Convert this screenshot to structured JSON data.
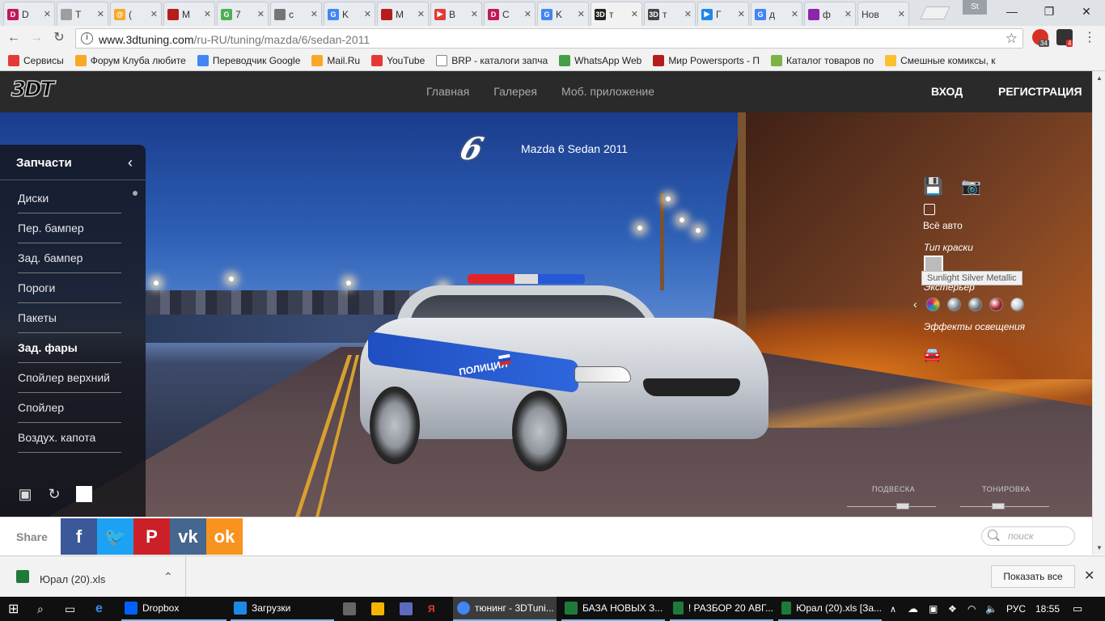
{
  "browser": {
    "tabs": [
      {
        "label": "D",
        "fav_color": "#c2185b",
        "fav_glyph": "D",
        "active": false
      },
      {
        "label": "T",
        "fav_color": "#9e9e9e",
        "fav_glyph": "",
        "active": false
      },
      {
        "label": "(",
        "fav_color": "#f9a825",
        "fav_glyph": "@",
        "active": false
      },
      {
        "label": "M",
        "fav_color": "#b71c1c",
        "fav_glyph": "",
        "active": false
      },
      {
        "label": "7",
        "fav_color": "#4caf50",
        "fav_glyph": "G",
        "active": false
      },
      {
        "label": "c",
        "fav_color": "#757575",
        "fav_glyph": "",
        "active": false
      },
      {
        "label": "K",
        "fav_color": "#4285f4",
        "fav_glyph": "G",
        "active": false
      },
      {
        "label": "M",
        "fav_color": "#b71c1c",
        "fav_glyph": "",
        "active": false
      },
      {
        "label": "B",
        "fav_color": "#e53935",
        "fav_glyph": "▶",
        "active": false
      },
      {
        "label": "C",
        "fav_color": "#c2185b",
        "fav_glyph": "D",
        "active": false
      },
      {
        "label": "K",
        "fav_color": "#4285f4",
        "fav_glyph": "G",
        "active": false
      },
      {
        "label": "т",
        "fav_color": "#222222",
        "fav_glyph": "3D",
        "active": true
      },
      {
        "label": "т",
        "fav_color": "#444444",
        "fav_glyph": "3D",
        "active": false
      },
      {
        "label": "Г",
        "fav_color": "#1e88e5",
        "fav_glyph": "▶",
        "active": false
      },
      {
        "label": "д",
        "fav_color": "#4285f4",
        "fav_glyph": "G",
        "active": false
      },
      {
        "label": "ф",
        "fav_color": "#8e24aa",
        "fav_glyph": "",
        "active": false
      },
      {
        "label": "Нов",
        "fav_color": "",
        "fav_glyph": "",
        "active": false
      }
    ],
    "profile_label": "St",
    "url_host": "www.3dtuning.com",
    "url_path": "/ru-RU/tuning/mazda/6/sedan-2011",
    "ext_badges": [
      "34",
      "4"
    ]
  },
  "bookmarks": [
    {
      "label": "Сервисы",
      "color": "#e53935"
    },
    {
      "label": "Форум Клуба любите",
      "color": "#f9a825"
    },
    {
      "label": "Переводчик Google",
      "color": "#4285f4"
    },
    {
      "label": "Mail.Ru",
      "color": "#f9a825"
    },
    {
      "label": "YouTube",
      "color": "#e53935"
    },
    {
      "label": "BRP - каталоги запча",
      "color": "#ffffff"
    },
    {
      "label": "WhatsApp Web",
      "color": "#43a047"
    },
    {
      "label": "Мир Powersports - П",
      "color": "#b71c1c"
    },
    {
      "label": "Каталог товаров по",
      "color": "#7cb342"
    },
    {
      "label": "Смешные комиксы, к",
      "color": "#fbc02d"
    }
  ],
  "site": {
    "logo": "3DT",
    "nav": [
      "Главная",
      "Галерея",
      "Моб. приложение"
    ],
    "login": "ВХОД",
    "register": "РЕГИСТРАЦИЯ",
    "model_logo": "6",
    "model_name": "Mazda 6 Sedan 2011",
    "car_text": "ПОЛИЦИЯ"
  },
  "panel": {
    "title": "Запчасти",
    "items": [
      {
        "label": "Диски",
        "active": false
      },
      {
        "label": "Пер. бампер",
        "active": false
      },
      {
        "label": "Зад. бампер",
        "active": false
      },
      {
        "label": "Пороги",
        "active": false
      },
      {
        "label": "Пакеты",
        "active": false
      },
      {
        "label": "Зад. фары",
        "active": true
      },
      {
        "label": "Спойлер верхний",
        "active": false
      },
      {
        "label": "Спойлер",
        "active": false
      },
      {
        "label": "Воздух. капота",
        "active": false
      }
    ]
  },
  "right_tools": {
    "all_car": "Всё авто",
    "paint_type": "Тип краски",
    "tooltip": "Sunlight Silver Metallic",
    "exterior": "Экстерьер",
    "lighting": "Эффекты освещения",
    "swatches": [
      "#9e9e9e",
      "#8a8e94",
      "#7a7f86",
      "#b0202a",
      "#c6c9cc"
    ],
    "suspension": "ПОДВЕСКА",
    "tint": "ТОНИРОВКА",
    "suspension_level": 0.65,
    "tint_level": 0.42
  },
  "share": {
    "label": "Share",
    "buttons": [
      {
        "name": "facebook",
        "glyph": "f",
        "color": "#3b5998"
      },
      {
        "name": "twitter",
        "glyph": "🐦",
        "color": "#1da1f2"
      },
      {
        "name": "pinterest",
        "glyph": "P",
        "color": "#cb2027"
      },
      {
        "name": "vk",
        "glyph": "vk",
        "color": "#45668e"
      },
      {
        "name": "odnoklassniki",
        "glyph": "ok",
        "color": "#f7931e"
      }
    ],
    "search_placeholder": "поиск"
  },
  "downloads": {
    "file": "Юрал (20).xls",
    "show_all": "Показать все"
  },
  "taskbar": {
    "items": [
      {
        "label": "Dropbox",
        "color": "#0061fe"
      },
      {
        "label": "Загрузки",
        "color": "#1e88e5"
      },
      {
        "label": "тюнинг - 3DTuni...",
        "color": "#4285f4"
      },
      {
        "label": "БАЗА НОВЫХ З...",
        "color": "#1f7a3a"
      },
      {
        "label": "! РАЗБОР 20 АВГ...",
        "color": "#1f7a3a"
      },
      {
        "label": "Юрал (20).xls [За...",
        "color": "#1f7a3a"
      }
    ],
    "lang": "РУС",
    "time": "18:55"
  }
}
